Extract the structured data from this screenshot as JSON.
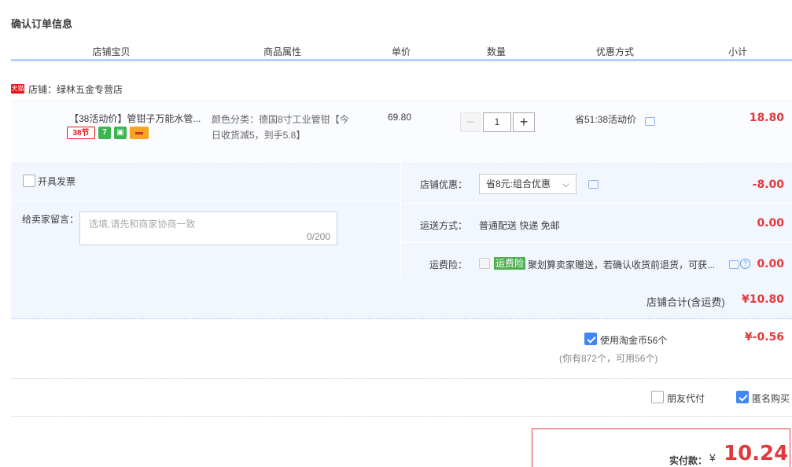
{
  "page_title": "确认订单信息",
  "table_headers": [
    "店铺宝贝",
    "商品属性",
    "单价",
    "数量",
    "优惠方式",
    "小计"
  ],
  "shop": {
    "tag": "天猫",
    "label": "店铺：绿林五金专营店"
  },
  "item": {
    "title": "【38活动价】管钳子万能水管...",
    "badges": [
      {
        "text": "38节",
        "color": "#e9151b",
        "icon": "festival-38-badge"
      },
      {
        "text": "7",
        "color": "#3fb34f",
        "icon": "seven-day-return-badge"
      },
      {
        "text": "▣",
        "color": "#3fb34f",
        "icon": "quality-guarantee-badge"
      },
      {
        "text": "▬",
        "color": "#f7a420",
        "icon": "credit-card-badge"
      }
    ],
    "attr_line1": "颜色分类：德国8寸工业管钳【今",
    "attr_line2": "日收货减5，到手5.8】",
    "price": "69.80",
    "qty_minus": "−",
    "qty_value": "1",
    "qty_plus": "+",
    "promo": "省51:38活动价",
    "subtotal": "18.80"
  },
  "invoice_label": "开具发票",
  "message": {
    "label": "给卖家留言：",
    "placeholder": "选填,请先和商家协商一致",
    "counter": "0/200"
  },
  "shop_discount": {
    "label": "店铺优惠：",
    "selected": "省8元:组合优惠",
    "amount": "-8.00"
  },
  "shipping": {
    "label": "运送方式：",
    "value": "普通配送 快递 免邮",
    "amount": "0.00"
  },
  "insurance": {
    "label": "运费险：",
    "tag": "运费险",
    "text": "聚划算卖家赠送，若确认收货前退货，可获...",
    "amount": "0.00"
  },
  "shop_total": {
    "label": "店铺合计(含运费)",
    "amount": "¥10.80"
  },
  "coins": {
    "label": "使用淘金币56个",
    "note": "(你有872个，可用56个)",
    "amount": "¥-0.56"
  },
  "friend_pay_label": "朋友代付",
  "anonymous_label": "匿名购买",
  "final": {
    "label": "实付款：",
    "currency": "¥",
    "amount": "10.24"
  },
  "colors": {
    "accent_red": "#e4393c",
    "header_line": "#b2d1ff",
    "panel_bg": "#f2f7ff",
    "checkbox_blue": "#3f86f7"
  }
}
